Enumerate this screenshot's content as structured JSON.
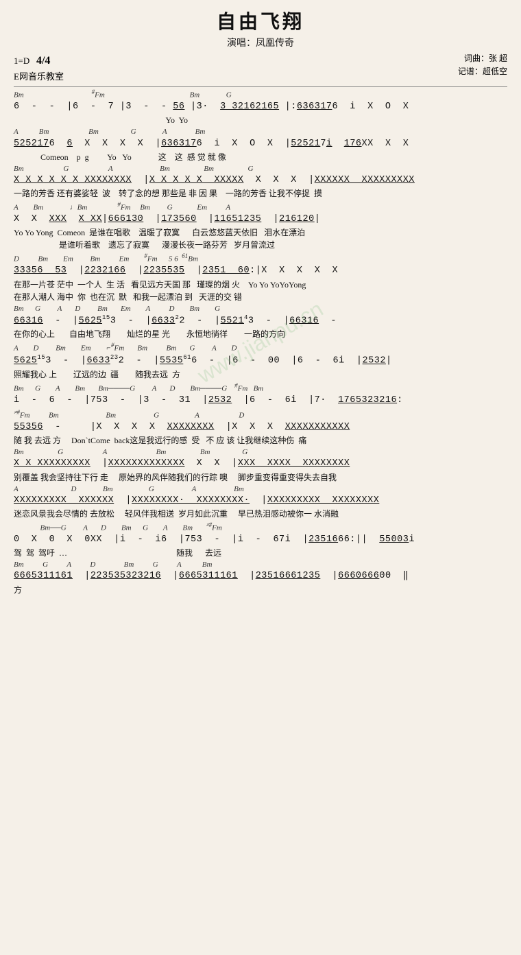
{
  "title": "自由飞翔",
  "performer": "演唱：凤凰传奇",
  "key": "1=D",
  "time_sig": "4/4",
  "school": "E网音乐教室",
  "lyricist": "词曲：张 超",
  "notation_author": "记谱：超低空",
  "watermark": "www.jianpu.cn",
  "sections": [
    {
      "id": "s1",
      "chords": "Bm                              #Fm                                    Bm        G",
      "notation": "6  -  -  |6  -  7 |3  -  - 5̲6̲ |3·  3̲ 3̲2̲1̲6̲2̲1̲6̲5̲ |:6̲3̲6̲3̲1̲7̲6̲ i  X  O  X",
      "lyric": "                                                                      Yo  Yo"
    },
    {
      "id": "s2",
      "chords": "A        Bm               Bm              G           A          Bm",
      "notation": "5̲2̲5̲2̲1̲7̲6̲  6̲  X  X  X  X  |6̲3̲6̲3̲1̲7̲6̲  i  X  O  X  |5̲2̲5̲2̲1̲7̲i̲  1̲7̲6̲X̲X̲  X  X",
      "lyric": "          Comeon    p  g    Yo   Yo         这   这  感 觉 就 像"
    },
    {
      "id": "s3",
      "chords": "Bm              G              A                Bm             Bm              G",
      "notation": "X̲ X̲ X̲ X̲ X̲ X̲ X̲X̲X̲X̲X̲X̲  |X̲ X̲ X̲ X̲ X̲  X̲X̲X̲X̲X̲  X  X  X  |X̲X̲X̲X̲X̲X̲  X̲X̲X̲X̲X̲X̲X̲X̲X̲",
      "lyric": "一路的芳香 还有婆娑轻  波    转了念的想 那些是 非 因 果   一路的芳香 让我不停捉  摸"
    },
    {
      "id": "s4",
      "chords": "A       Bm          𝄞Bm            #Fm    Bm     G         Em       A",
      "notation": "X  X  X̲X̲X̲  X̲ X̲X̲|6̲6̲6̲1̲3̲0̲  |1̲7̲3̲5̲6̲0̲  |1̲1̲6̲5̲1̲2̲3̲5̲  |2̲1̲6̲1̲2̲0̲|",
      "lyric1": "Yo Yo Yong  Comeon   是谁在唱歌    温暖了寂寞      白云悠悠蓝天依旧  泪水在漂泊",
      "lyric2": "             是谁听着歌    遗忘了寂寞      漫漫长夜一路芬芳  岁月曾流过"
    },
    {
      "id": "s5",
      "chords": "D        Bm      Em       Bm         Em       #Fm      5 6   Bm",
      "notation": "3̲3̲3̲5̲6̲  5̲3̲  |2̲2̲3̲2̲1̲6̲6̲  |2̲2̲3̲5̲5̲3̲  3̲5̲  |2̲3̲5̲1̲  6̲0̲:|X  X  X  X  X",
      "lyric1": "在那一片苍 茫中  一个人  生 活   看见远方天国 那   瑾璨的烟 火    Yo Yo YoYoYong",
      "lyric2": "在那人潮人 海中  你  也在沉  默   和我一起漂泊 到   天涯的交 错"
    },
    {
      "id": "s6",
      "chords": "Bm     G       A       D       Bm       Em      A        D       Bm      G",
      "notation": "6̲6̲3̲1̲6̲  -  |5̲6̲2̲5̲3̲  -  |6̲6̲3̲3̲2̲  -  |5̲5̲2̲1̲3̲  -  |6̲6̲3̲1̲6̲  -",
      "lyric": "在你的心上      自由地飞翔      灿烂的星 光      永恒地徜徉      一路的方向"
    },
    {
      "id": "s7",
      "chords": "A       D       Bm       Em       #Fm      Bm       Bm      G       A       D",
      "notation": "5̲6̲2̲5̲3̲  -  |6̲6̲3̲3̲2̲  -  |5̲5̲3̲5̲6̲  -  |6̲  -  0̲0̲  |6̲  -  6̲i̲  |2̲5̲3̲2̲|",
      "lyric": "照耀我心 上      辽远的边  疆      随我去远  方"
    },
    {
      "id": "s8",
      "chords": "Bm     G       A       Bm     Bm────G       A      D       Bm────G    #Fm    Bm",
      "notation": "i̲  -  6̲  -  |7̲5̲3̲  -  |3̲  -  3̲1̲  |2̲5̲3̲2̲  |6̲  -  6̲i̲  |7̲·  1̲7̲6̲5̲3̲2̲3̲2̲1̲6̲:",
      "lyric": ""
    },
    {
      "id": "s9",
      "chords": "𝄎#Fm      Bm                   Bm              G                A               D",
      "notation": "5̲5̲3̲5̲6̲  -     |X  X  X  X  X̲X̲X̲X̲X̲X̲X̲X̲  |X  X  X̲  X̲X̲X̲X̲X̲X̲X̲X̲X̲X̲X̲",
      "lyric": "随 我 去远 方     Don`tCome  back这是我远行的感 受   不 应 该 让我继续这种伤 痛"
    },
    {
      "id": "s10",
      "chords": "Bm              G                A                    Bm              Bm             G",
      "notation": "X̲ X̲ X̲X̲X̲X̲X̲X̲X̲X̲X̲  |X̲X̲X̲X̲X̲X̲X̲X̲X̲X̲X̲X̲X̲  X  X  |X̲X̲X̲  X̲X̲X̲X̲  X̲X̲X̲X̲X̲X̲X̲X̲",
      "lyric": "别覆盖 我会坚持往下行 走    原始界的风伴随我们的行踪 噢    脚步重变得重变得失去自我"
    },
    {
      "id": "s11",
      "chords": "A                        D           Bm              G                A              Bm",
      "notation": "X̲X̲X̲X̲X̲X̲X̲X̲X̲  X̲X̲X̲X̲X̲X̲  |X̲X̲X̲X̲X̲X̲X̲X̲·  X̲X̲X̲X̲X̲X̲X̲X̲·  |X̲X̲X̲X̲X̲X̲X̲X̲X̲  X̲X̲X̲X̲X̲X̲X̲X̲",
      "lyric1": "迷恋风景我会尽情的 去放松    轻风伴我相送  岁月如此沉重    早已热泪感动被你一 水消融",
      "lyric2": ""
    },
    {
      "id": "s12",
      "chords": "          Bm──G       A      D       Bm      G       A       Bm      𝄎#Fm",
      "notation": "0  X  0  X  0̲X̲X̲  |i̲  -  i̲6̲  |7̲5̲3̲  -  |i̲  -  6̲7̲i̲  |2̲3̲5̲1̲6̲6̲6̲:||  5̲5̲0̲0̲3̲i̲",
      "lyric": "驾  驾  驾吁  …                                                随我    去远"
    },
    {
      "id": "s13",
      "chords": "Bm       G       A       D           Bm       G       A       Bm",
      "notation": "6̲6̲6̲5̲3̲1̲1̲1̲6̲1̲  |2̲2̲3̲5̲3̲5̲3̲2̲3̲2̲1̲6̲  |6̲6̲6̲5̲3̲1̲1̲1̲6̲1̲  |2̲3̲5̲1̲6̲6̲6̲1̲2̲3̲5̲  |6̲6̲6̲0̲6̲6̲6̲0̲0̲  ‖",
      "lyric": "方"
    }
  ]
}
